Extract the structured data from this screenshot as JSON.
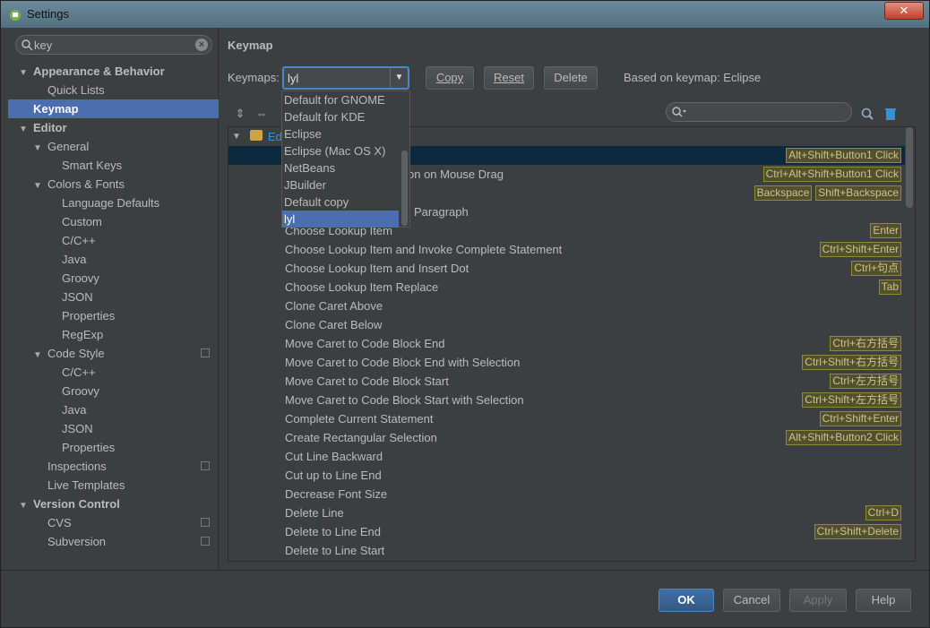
{
  "window": {
    "title": "Settings",
    "close_label": "✕"
  },
  "sidebar": {
    "search_value": "key",
    "items": [
      {
        "label": "Appearance & Behavior",
        "level": 0,
        "arrow": "▼",
        "bold": true
      },
      {
        "label": "Quick Lists",
        "level": 1
      },
      {
        "label": "Keymap",
        "level": 0,
        "bold": true,
        "selected": true
      },
      {
        "label": "Editor",
        "level": 0,
        "arrow": "▼",
        "bold": true
      },
      {
        "label": "General",
        "level": 1,
        "arrow": "▼"
      },
      {
        "label": "Smart Keys",
        "level": 2
      },
      {
        "label": "Colors & Fonts",
        "level": 1,
        "arrow": "▼"
      },
      {
        "label": "Language Defaults",
        "level": 2
      },
      {
        "label": "Custom",
        "level": 2
      },
      {
        "label": "C/C++",
        "level": 2
      },
      {
        "label": "Java",
        "level": 2
      },
      {
        "label": "Groovy",
        "level": 2
      },
      {
        "label": "JSON",
        "level": 2
      },
      {
        "label": "Properties",
        "level": 2
      },
      {
        "label": "RegExp",
        "level": 2
      },
      {
        "label": "Code Style",
        "level": 1,
        "arrow": "▼",
        "copy": true
      },
      {
        "label": "C/C++",
        "level": 2
      },
      {
        "label": "Groovy",
        "level": 2
      },
      {
        "label": "Java",
        "level": 2
      },
      {
        "label": "JSON",
        "level": 2
      },
      {
        "label": "Properties",
        "level": 2
      },
      {
        "label": "Inspections",
        "level": 1,
        "copy": true
      },
      {
        "label": "Live Templates",
        "level": 1
      },
      {
        "label": "Version Control",
        "level": 0,
        "arrow": "▼",
        "bold": true
      },
      {
        "label": "CVS",
        "level": 1,
        "copy": true
      },
      {
        "label": "Subversion",
        "level": 1,
        "copy": true
      }
    ]
  },
  "main": {
    "heading": "Keymap",
    "keymaps_label": "Keymaps:",
    "keymap_value": "lyl",
    "copy": "Copy",
    "reset": "Reset",
    "delete": "Delete",
    "based_on": "Based on keymap: Eclipse",
    "tree_root": "Ed",
    "dropdown": [
      "Default for GNOME",
      "Default for KDE",
      "Eclipse",
      "Eclipse (Mac OS X)",
      "NetBeans",
      "JBuilder",
      "Default copy",
      "lyl"
    ],
    "actions": [
      {
        "label": "",
        "shortcuts": [
          "Alt+Shift+Button1 Click"
        ],
        "hl": true
      },
      {
        "label": "on on Mouse Drag",
        "shortcuts": [
          "Ctrl+Alt+Shift+Button1 Click"
        ],
        "offset": true
      },
      {
        "label": "",
        "shortcuts": [
          "Backspace",
          "Shift+Backspace"
        ]
      },
      {
        "label": "Paragraph",
        "shortcuts": [],
        "offset2": true
      },
      {
        "label": "Choose Lookup Item",
        "shortcuts": [
          "Enter"
        ]
      },
      {
        "label": "Choose Lookup Item and Invoke Complete Statement",
        "shortcuts": [
          "Ctrl+Shift+Enter"
        ]
      },
      {
        "label": "Choose Lookup Item and Insert Dot",
        "shortcuts": [
          "Ctrl+句点"
        ]
      },
      {
        "label": "Choose Lookup Item Replace",
        "shortcuts": [
          "Tab"
        ]
      },
      {
        "label": "Clone Caret Above",
        "shortcuts": []
      },
      {
        "label": "Clone Caret Below",
        "shortcuts": []
      },
      {
        "label": "Move Caret to Code Block End",
        "shortcuts": [
          "Ctrl+右方括号"
        ]
      },
      {
        "label": "Move Caret to Code Block End with Selection",
        "shortcuts": [
          "Ctrl+Shift+右方括号"
        ]
      },
      {
        "label": "Move Caret to Code Block Start",
        "shortcuts": [
          "Ctrl+左方括号"
        ]
      },
      {
        "label": "Move Caret to Code Block Start with Selection",
        "shortcuts": [
          "Ctrl+Shift+左方括号"
        ]
      },
      {
        "label": "Complete Current Statement",
        "shortcuts": [
          "Ctrl+Shift+Enter"
        ]
      },
      {
        "label": "Create Rectangular Selection",
        "shortcuts": [
          "Alt+Shift+Button2 Click"
        ]
      },
      {
        "label": "Cut Line Backward",
        "shortcuts": []
      },
      {
        "label": "Cut up to Line End",
        "shortcuts": []
      },
      {
        "label": "Decrease Font Size",
        "shortcuts": []
      },
      {
        "label": "Delete Line",
        "shortcuts": [
          "Ctrl+D"
        ]
      },
      {
        "label": "Delete to Line End",
        "shortcuts": [
          "Ctrl+Shift+Delete"
        ]
      },
      {
        "label": "Delete to Line Start",
        "shortcuts": []
      }
    ]
  },
  "footer": {
    "ok": "OK",
    "cancel": "Cancel",
    "apply": "Apply",
    "help": "Help"
  }
}
